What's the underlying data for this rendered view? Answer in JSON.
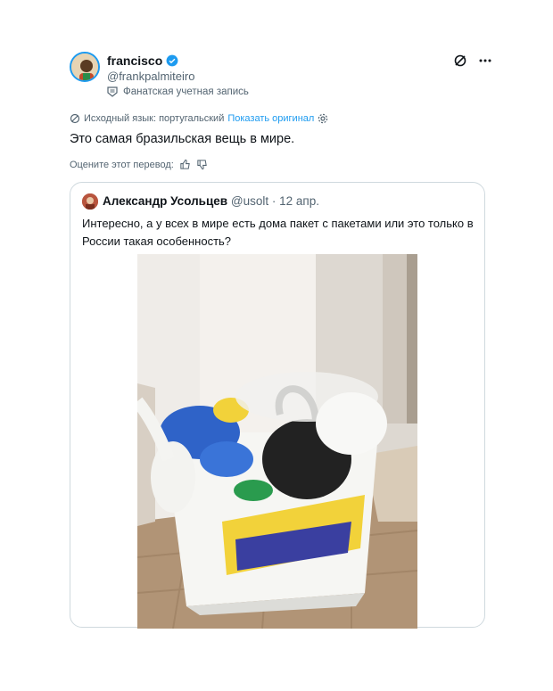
{
  "author": {
    "name": "francisco",
    "handle": "@frankpalmiteiro",
    "label": "Фанатская учетная запись"
  },
  "translation": {
    "source": "Исходный язык: португальский",
    "show_original": "Показать оригинал"
  },
  "tweet": {
    "text": "Это самая бразильская вещь в мире."
  },
  "rate": {
    "label": "Оцените этот перевод:"
  },
  "quote": {
    "name": "Александр Усольцев",
    "handle": "@usolt",
    "sep": "·",
    "date": "12 апр.",
    "text": "Интересно, а у всех в мире есть дома пакет с пакетами или это только в России такая особенность?"
  },
  "icons": [
    "verified-icon",
    "grok-icon",
    "more-icon",
    "fan-badge-icon",
    "translate-icon",
    "settings-icon",
    "thumbs-up-icon",
    "thumbs-down-icon"
  ],
  "colors": {
    "accent": "#1d9bf0",
    "muted": "#536471",
    "text": "#0f1419",
    "border": "#cfd9de"
  }
}
